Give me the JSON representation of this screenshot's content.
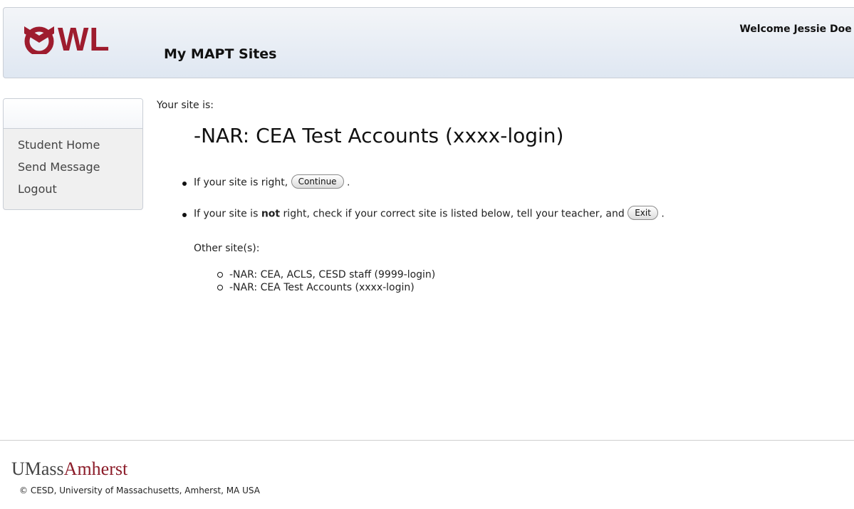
{
  "header": {
    "logo_text": "WL",
    "page_title": "My MAPT Sites",
    "welcome": "Welcome Jessie Doe !"
  },
  "sidebar": {
    "items": [
      {
        "label": "Student Home"
      },
      {
        "label": "Send Message"
      },
      {
        "label": "Logout"
      }
    ]
  },
  "content": {
    "your_site_label": "Your site is:",
    "site_name": "-NAR: CEA Test Accounts (xxxx-login)",
    "right_text": "If your site is right,",
    "continue_label": "Continue",
    "not_right_prefix": "If your site is",
    "not_right_bold": "not",
    "not_right_suffix": "right, check if your correct site is listed below, tell your teacher, and",
    "exit_label": "Exit",
    "period": ".",
    "other_sites_label": "Other site(s):",
    "other_sites": [
      "-NAR: CEA, ACLS, CESD staff (9999-login)",
      "-NAR: CEA Test Accounts (xxxx-login)"
    ]
  },
  "footer": {
    "umass_part": "UMass",
    "amherst_part": "Amherst",
    "copyright": "© CESD, University of Massachusetts, Amherst, MA USA"
  },
  "colors": {
    "brand": "#9e1c2e",
    "header_gradient_top": "#f3f5f8",
    "header_gradient_bottom": "#dfe7f2"
  }
}
